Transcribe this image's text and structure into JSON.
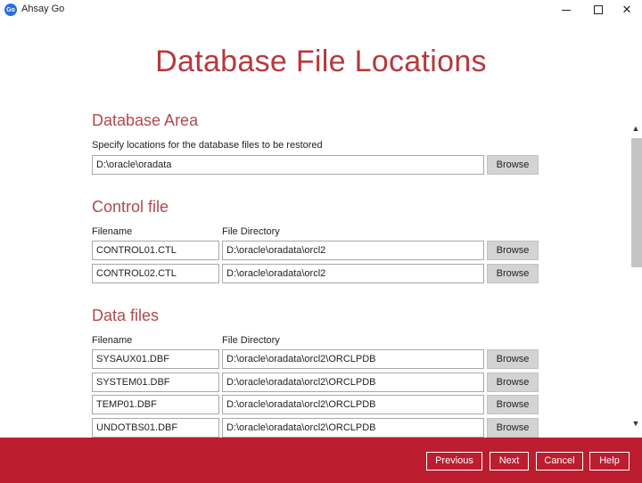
{
  "window": {
    "app_icon_text": "Go",
    "title": "Ahsay Go",
    "minimize_glyph": "",
    "maximize_glyph": "",
    "close_glyph": "✕"
  },
  "page": {
    "title": "Database File Locations"
  },
  "database_area": {
    "heading": "Database Area",
    "instruction": "Specify locations for the database files to be restored",
    "path": "D:\\oracle\\oradata",
    "browse_label": "Browse"
  },
  "control_file": {
    "heading": "Control file",
    "col_filename": "Filename",
    "col_directory": "File Directory",
    "rows": [
      {
        "filename": "CONTROL01.CTL",
        "directory": "D:\\oracle\\oradata\\orcl2",
        "browse": "Browse"
      },
      {
        "filename": "CONTROL02.CTL",
        "directory": "D:\\oracle\\oradata\\orcl2",
        "browse": "Browse"
      }
    ]
  },
  "data_files": {
    "heading": "Data files",
    "col_filename": "Filename",
    "col_directory": "File Directory",
    "rows": [
      {
        "filename": "SYSAUX01.DBF",
        "directory": "D:\\oracle\\oradata\\orcl2\\ORCLPDB",
        "browse": "Browse"
      },
      {
        "filename": "SYSTEM01.DBF",
        "directory": "D:\\oracle\\oradata\\orcl2\\ORCLPDB",
        "browse": "Browse"
      },
      {
        "filename": "TEMP01.DBF",
        "directory": "D:\\oracle\\oradata\\orcl2\\ORCLPDB",
        "browse": "Browse"
      },
      {
        "filename": "UNDOTBS01.DBF",
        "directory": "D:\\oracle\\oradata\\orcl2\\ORCLPDB",
        "browse": "Browse"
      }
    ]
  },
  "scrollbar": {
    "up_glyph": "▲",
    "down_glyph": "▼"
  },
  "footer": {
    "previous_label": "Previous",
    "next_label": "Next",
    "cancel_label": "Cancel",
    "help_label": "Help"
  },
  "colors": {
    "accent_title": "#b8383d",
    "section_heading": "#b04a4f",
    "footer_bg": "#bc1d2f",
    "button_bg": "#d3d3d3"
  }
}
